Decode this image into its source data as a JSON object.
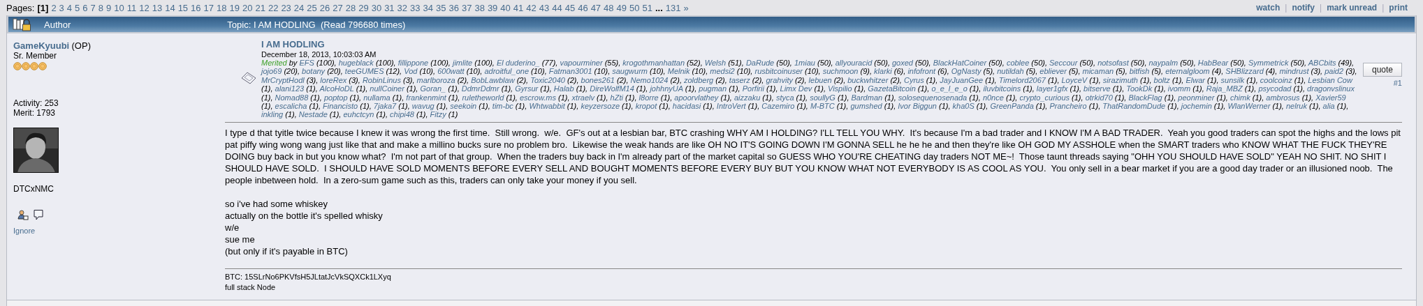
{
  "pages": {
    "label": "Pages:",
    "items": [
      {
        "label": "[1]",
        "selected": true
      },
      {
        "label": "2",
        "selected": false
      },
      {
        "label": "3",
        "selected": false
      },
      {
        "label": "4",
        "selected": false
      },
      {
        "label": "5",
        "selected": false
      },
      {
        "label": "6",
        "selected": false
      },
      {
        "label": "7",
        "selected": false
      },
      {
        "label": "8",
        "selected": false
      },
      {
        "label": "9",
        "selected": false
      },
      {
        "label": "10",
        "selected": false
      },
      {
        "label": "11",
        "selected": false
      },
      {
        "label": "12",
        "selected": false
      },
      {
        "label": "13",
        "selected": false
      },
      {
        "label": "14",
        "selected": false
      },
      {
        "label": "15",
        "selected": false
      },
      {
        "label": "16",
        "selected": false
      },
      {
        "label": "17",
        "selected": false
      },
      {
        "label": "18",
        "selected": false
      },
      {
        "label": "19",
        "selected": false
      },
      {
        "label": "20",
        "selected": false
      },
      {
        "label": "21",
        "selected": false
      },
      {
        "label": "22",
        "selected": false
      },
      {
        "label": "23",
        "selected": false
      },
      {
        "label": "24",
        "selected": false
      },
      {
        "label": "25",
        "selected": false
      },
      {
        "label": "26",
        "selected": false
      },
      {
        "label": "27",
        "selected": false
      },
      {
        "label": "28",
        "selected": false
      },
      {
        "label": "29",
        "selected": false
      },
      {
        "label": "30",
        "selected": false
      },
      {
        "label": "31",
        "selected": false
      },
      {
        "label": "32",
        "selected": false
      },
      {
        "label": "33",
        "selected": false
      },
      {
        "label": "34",
        "selected": false
      },
      {
        "label": "35",
        "selected": false
      },
      {
        "label": "36",
        "selected": false
      },
      {
        "label": "37",
        "selected": false
      },
      {
        "label": "38",
        "selected": false
      },
      {
        "label": "39",
        "selected": false
      },
      {
        "label": "40",
        "selected": false
      },
      {
        "label": "41",
        "selected": false
      },
      {
        "label": "42",
        "selected": false
      },
      {
        "label": "43",
        "selected": false
      },
      {
        "label": "44",
        "selected": false
      },
      {
        "label": "45",
        "selected": false
      },
      {
        "label": "46",
        "selected": false
      },
      {
        "label": "47",
        "selected": false
      },
      {
        "label": "48",
        "selected": false
      },
      {
        "label": "49",
        "selected": false
      },
      {
        "label": "50",
        "selected": false
      },
      {
        "label": "51",
        "selected": false
      }
    ],
    "ellipsis": "...",
    "last": [
      {
        "label": "131"
      },
      {
        "label": "»"
      }
    ]
  },
  "actions": {
    "items": [
      "watch",
      "notify",
      "mark unread",
      "print"
    ],
    "separator": "|"
  },
  "header": {
    "author": "Author",
    "topic": "Topic: I AM HODLING  (Read 796680 times)"
  },
  "author": {
    "name": "GameKyuubi",
    "tag": "(OP)",
    "rank": "Sr. Member",
    "stars": 4,
    "activity": "Activity: 253",
    "merit": "Merit: 1793",
    "personal_text": "DTCxNMC",
    "ignore": "Ignore"
  },
  "post": {
    "title": "I AM HODLING",
    "date": "December 18, 2013, 10:03:03 AM",
    "merited_label": "Merited",
    "merited_by": "by",
    "merit_separator": ",",
    "merits": [
      {
        "name": "EFS",
        "points": "(100)"
      },
      {
        "name": "hugeblack",
        "points": "(100)"
      },
      {
        "name": "fillippone",
        "points": "(100)"
      },
      {
        "name": "jimlite",
        "points": "(100)"
      },
      {
        "name": "El duderino_",
        "points": "(77)"
      },
      {
        "name": "vapourminer",
        "points": "(55)"
      },
      {
        "name": "krogothmanhattan",
        "points": "(52)"
      },
      {
        "name": "Welsh",
        "points": "(51)"
      },
      {
        "name": "DaRude",
        "points": "(50)"
      },
      {
        "name": "1miau",
        "points": "(50)"
      },
      {
        "name": "allyouracid",
        "points": "(50)"
      },
      {
        "name": "goxed",
        "points": "(50)"
      },
      {
        "name": "BlackHatCoiner",
        "points": "(50)"
      },
      {
        "name": "coblee",
        "points": "(50)"
      },
      {
        "name": "Seccour",
        "points": "(50)"
      },
      {
        "name": "notsofast",
        "points": "(50)"
      },
      {
        "name": "naypalm",
        "points": "(50)"
      },
      {
        "name": "HabBear",
        "points": "(50)"
      },
      {
        "name": "Symmetrick",
        "points": "(50)"
      },
      {
        "name": "ABCbits",
        "points": "(49)"
      },
      {
        "name": "jojo69",
        "points": "(20)"
      },
      {
        "name": "botany",
        "points": "(20)"
      },
      {
        "name": "teeGUMES",
        "points": "(12)"
      },
      {
        "name": "Vod",
        "points": "(10)"
      },
      {
        "name": "600watt",
        "points": "(10)"
      },
      {
        "name": "adroitful_one",
        "points": "(10)"
      },
      {
        "name": "Fatman3001",
        "points": "(10)"
      },
      {
        "name": "saugwurm",
        "points": "(10)"
      },
      {
        "name": "Melnik",
        "points": "(10)"
      },
      {
        "name": "medsi2",
        "points": "(10)"
      },
      {
        "name": "rusbitcoinuser",
        "points": "(10)"
      },
      {
        "name": "suchmoon",
        "points": "(9)"
      },
      {
        "name": "klarki",
        "points": "(6)"
      },
      {
        "name": "infofront",
        "points": "(6)"
      },
      {
        "name": "OgNasty",
        "points": "(5)"
      },
      {
        "name": "nutildah",
        "points": "(5)"
      },
      {
        "name": "ebliever",
        "points": "(5)"
      },
      {
        "name": "micaman",
        "points": "(5)"
      },
      {
        "name": "bitfish",
        "points": "(5)"
      },
      {
        "name": "eternalgloom",
        "points": "(4)"
      },
      {
        "name": "SHBlizzard",
        "points": "(4)"
      },
      {
        "name": "mindrust",
        "points": "(3)"
      },
      {
        "name": "paid2",
        "points": "(3)"
      },
      {
        "name": "MrCryptHodl",
        "points": "(3)"
      },
      {
        "name": "loreRex",
        "points": "(3)"
      },
      {
        "name": "RobinLinus",
        "points": "(3)"
      },
      {
        "name": "marlboroza",
        "points": "(2)"
      },
      {
        "name": "BobLawblaw",
        "points": "(2)"
      },
      {
        "name": "Toxic2040",
        "points": "(2)"
      },
      {
        "name": "bones261",
        "points": "(2)"
      },
      {
        "name": "Nemo1024",
        "points": "(2)"
      },
      {
        "name": "zoldberg",
        "points": "(2)"
      },
      {
        "name": "taserz",
        "points": "(2)"
      },
      {
        "name": "grahvity",
        "points": "(2)"
      },
      {
        "name": "lebuen",
        "points": "(2)"
      },
      {
        "name": "buckwhitzer",
        "points": "(2)"
      },
      {
        "name": "Cyrus",
        "points": "(1)"
      },
      {
        "name": "JayJuanGee",
        "points": "(1)"
      },
      {
        "name": "Timelord2067",
        "points": "(1)"
      },
      {
        "name": "LoyceV",
        "points": "(1)"
      },
      {
        "name": "sirazimuth",
        "points": "(1)"
      },
      {
        "name": "boltz",
        "points": "(1)"
      },
      {
        "name": "Elwar",
        "points": "(1)"
      },
      {
        "name": "sunsilk",
        "points": "(1)"
      },
      {
        "name": "coolcoinz",
        "points": "(1)"
      },
      {
        "name": "Lesbian Cow",
        "points": "(1)"
      },
      {
        "name": "alani123",
        "points": "(1)"
      },
      {
        "name": "AlcoHoDL",
        "points": "(1)"
      },
      {
        "name": "nullCoiner",
        "points": "(1)"
      },
      {
        "name": "Goran_",
        "points": "(1)"
      },
      {
        "name": "DdmrDdmr",
        "points": "(1)"
      },
      {
        "name": "Gyrsur",
        "points": "(1)"
      },
      {
        "name": "Halab",
        "points": "(1)"
      },
      {
        "name": "DireWolfM14",
        "points": "(1)"
      },
      {
        "name": "johhnyUA",
        "points": "(1)"
      },
      {
        "name": "pugman",
        "points": "(1)"
      },
      {
        "name": "Porfirii",
        "points": "(1)"
      },
      {
        "name": "Limx Dev",
        "points": "(1)"
      },
      {
        "name": "Vispilio",
        "points": "(1)"
      },
      {
        "name": "GazetaBitcoin",
        "points": "(1)"
      },
      {
        "name": "o_e_l_e_o",
        "points": "(1)"
      },
      {
        "name": "iluvbitcoins",
        "points": "(1)"
      },
      {
        "name": "layer1gfx",
        "points": "(1)"
      },
      {
        "name": "bitserve",
        "points": "(1)"
      },
      {
        "name": "TookDk",
        "points": "(1)"
      },
      {
        "name": "ivomm",
        "points": "(1)"
      },
      {
        "name": "Raja_MBZ",
        "points": "(1)"
      },
      {
        "name": "psycodad",
        "points": "(1)"
      },
      {
        "name": "dragonvslinux",
        "points": "(1)"
      },
      {
        "name": "Nomad88",
        "points": "(1)"
      },
      {
        "name": "poptop",
        "points": "(1)"
      },
      {
        "name": "nullama",
        "points": "(1)"
      },
      {
        "name": "frankenmint",
        "points": "(1)"
      },
      {
        "name": "ruletheworld",
        "points": "(1)"
      },
      {
        "name": "escrow.ms",
        "points": "(1)"
      },
      {
        "name": "xtraelv",
        "points": "(1)"
      },
      {
        "name": "hZti",
        "points": "(1)"
      },
      {
        "name": "l8orre",
        "points": "(1)"
      },
      {
        "name": "apoorvlathey",
        "points": "(1)"
      },
      {
        "name": "aizzaku",
        "points": "(1)"
      },
      {
        "name": "styca",
        "points": "(1)"
      },
      {
        "name": "soullyG",
        "points": "(1)"
      },
      {
        "name": "Bardman",
        "points": "(1)"
      },
      {
        "name": "solosequenosenada",
        "points": "(1)"
      },
      {
        "name": "n0nce",
        "points": "(1)"
      },
      {
        "name": "crypto_curious",
        "points": "(1)"
      },
      {
        "name": "otrkid70",
        "points": "(1)"
      },
      {
        "name": "BlackFlag",
        "points": "(1)"
      },
      {
        "name": "peonminer",
        "points": "(1)"
      },
      {
        "name": "chimk",
        "points": "(1)"
      },
      {
        "name": "ambrosus",
        "points": "(1)"
      },
      {
        "name": "Xavier59",
        "points": "(1)"
      },
      {
        "name": "escalicha",
        "points": "(1)"
      },
      {
        "name": "Financisto",
        "points": "(1)"
      },
      {
        "name": "7jaka7",
        "points": "(1)"
      },
      {
        "name": "wavug",
        "points": "(1)"
      },
      {
        "name": "seekoin",
        "points": "(1)"
      },
      {
        "name": "tim-bc",
        "points": "(1)"
      },
      {
        "name": "Whtwabbit",
        "points": "(1)"
      },
      {
        "name": "keyzersoze",
        "points": "(1)"
      },
      {
        "name": "kropot",
        "points": "(1)"
      },
      {
        "name": "hacidasi",
        "points": "(1)"
      },
      {
        "name": "IntroVert",
        "points": "(1)"
      },
      {
        "name": "Cazemiro",
        "points": "(1)"
      },
      {
        "name": "M-BTC",
        "points": "(1)"
      },
      {
        "name": "gumshed",
        "points": "(1)"
      },
      {
        "name": "Ivor Biggun",
        "points": "(1)"
      },
      {
        "name": "kha0S",
        "points": "(1)"
      },
      {
        "name": "GreenPanda",
        "points": "(1)"
      },
      {
        "name": "Prancheiro",
        "points": "(1)"
      },
      {
        "name": "ThatRandomDude",
        "points": "(1)"
      },
      {
        "name": "jochemin",
        "points": "(1)"
      },
      {
        "name": "WlanWerner",
        "points": "(1)"
      },
      {
        "name": "nelruk",
        "points": "(1)"
      },
      {
        "name": "alia",
        "points": "(1)"
      },
      {
        "name": "inkling",
        "points": "(1)"
      },
      {
        "name": "Nestade",
        "points": "(1)"
      },
      {
        "name": "euhctcyn",
        "points": "(1)"
      },
      {
        "name": "chipi48",
        "points": "(1)"
      },
      {
        "name": "Fitzy",
        "points": "(1)"
      }
    ],
    "quote_button": "quote",
    "number": "#1",
    "body": "I type d that tyitle twice because I knew it was wrong the first time.  Still wrong.  w/e.  GF's out at a lesbian bar, BTC crashing WHY AM I HOLDING? I'LL TELL YOU WHY.  It's because I'm a bad trader and I KNOW I'M A BAD TRADER.  Yeah you good traders can spot the highs and the lows pit pat piffy wing wong wang just like that and make a millino bucks sure no problem bro.  Likewise the weak hands are like OH NO IT'S GOING DOWN I'M GONNA SELL he he he and then they're like OH GOD MY ASSHOLE when the SMART traders who KNOW WHAT THE FUCK THEY'RE DOING buy back in but you know what?  I'm not part of that group.  When the traders buy back in I'm already part of the market capital so GUESS WHO YOU'RE CHEATING day traders NOT ME~!  Those taunt threads saying \"OHH YOU SHOULD HAVE SOLD\" YEAH NO SHIT. NO SHIT I SHOULD HAVE SOLD.  I SHOULD HAVE SOLD MOMENTS BEFORE EVERY SELL AND BOUGHT MOMENTS BEFORE EVERY BUY BUT YOU KNOW WHAT NOT EVERYBODY IS AS COOL AS YOU.  You only sell in a bear market if you are a good day trader or an illusioned noob.  The people inbetween hold.  In a zero-sum game such as this, traders can only take your money if you sell.",
    "lines": [
      "so i've had some whiskey",
      "actually on the bottle it's spelled whisky",
      "w/e",
      "sue me",
      "(but only if it's payable in BTC)"
    ],
    "signature": [
      "BTC: 15SLrNo6PKVfsH5JLtatJcVkSQXCk1LXyq",
      "full stack Node"
    ]
  }
}
